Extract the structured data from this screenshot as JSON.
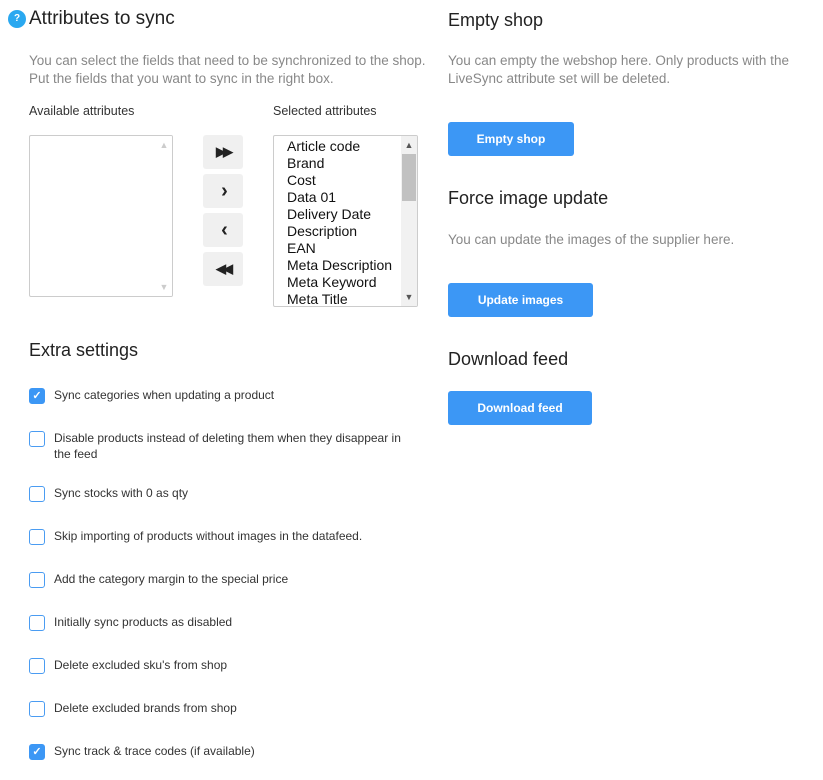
{
  "attributes": {
    "title": "Attributes to sync",
    "help_icon": "?",
    "description": [
      "You can select the fields that need to be synchronized to the shop.",
      "Put the fields that you want to sync in the right box."
    ],
    "available_label": "Available attributes",
    "selected_label": "Selected attributes",
    "available": [],
    "selected": [
      "Article code",
      "Brand",
      "Cost",
      "Data 01",
      "Delivery Date",
      "Description",
      "EAN",
      "Meta Description",
      "Meta Keyword",
      "Meta Title"
    ],
    "move_buttons": [
      {
        "icon": "double-chevron-right-icon",
        "glyph": "▶▶"
      },
      {
        "icon": "chevron-right-icon",
        "glyph": "›"
      },
      {
        "icon": "chevron-left-icon",
        "glyph": "‹"
      },
      {
        "icon": "double-chevron-left-icon",
        "glyph": "◀◀"
      }
    ]
  },
  "extra": {
    "title": "Extra settings",
    "options": [
      {
        "label": "Sync categories when updating a product",
        "checked": true
      },
      {
        "label": "Disable products instead of deleting them when they disappear in the feed",
        "checked": false
      },
      {
        "label": "Sync stocks with 0 as qty",
        "checked": false
      },
      {
        "label": "Skip importing of products without images in the datafeed.",
        "checked": false
      },
      {
        "label": "Add the category margin to the special price",
        "checked": false
      },
      {
        "label": "Initially sync products as disabled",
        "checked": false
      },
      {
        "label": "Delete excluded sku's from shop",
        "checked": false
      },
      {
        "label": "Delete excluded brands from shop",
        "checked": false
      },
      {
        "label": "Sync track & trace codes (if available)",
        "checked": true
      }
    ]
  },
  "empty_shop": {
    "title": "Empty shop",
    "description": "You can empty the webshop here. Only products with the LiveSync attribute set will be deleted.",
    "button": "Empty shop"
  },
  "image_update": {
    "title": "Force image update",
    "description": "You can update the images of the supplier here.",
    "button": "Update images"
  },
  "download": {
    "title": "Download feed",
    "button": "Download feed"
  },
  "colors": {
    "accent": "#3c97f5",
    "help": "#2aa8f0"
  }
}
